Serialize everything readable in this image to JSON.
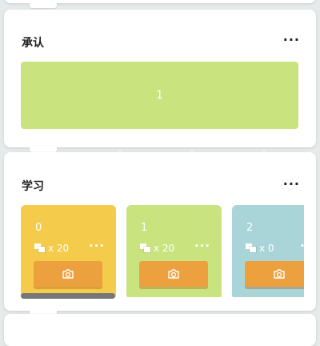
{
  "cards": [
    {
      "title": "承认",
      "more_label": "···",
      "block_label": "1",
      "block_color": "#c9e47e"
    },
    {
      "title": "学习",
      "more_label": "···"
    }
  ],
  "learn_items": [
    {
      "number": "0",
      "quantity": "x 20",
      "more_label": "···",
      "color": "#f4cb4a"
    },
    {
      "number": "1",
      "quantity": "x 20",
      "more_label": "···",
      "color": "#c9e47e"
    },
    {
      "number": "2",
      "quantity": "x 0",
      "more_label": "···",
      "color": "#a9d4d8"
    }
  ],
  "button_color": "#eda13e",
  "icons": [
    "more-icon",
    "stack-icon",
    "camera-icon"
  ]
}
